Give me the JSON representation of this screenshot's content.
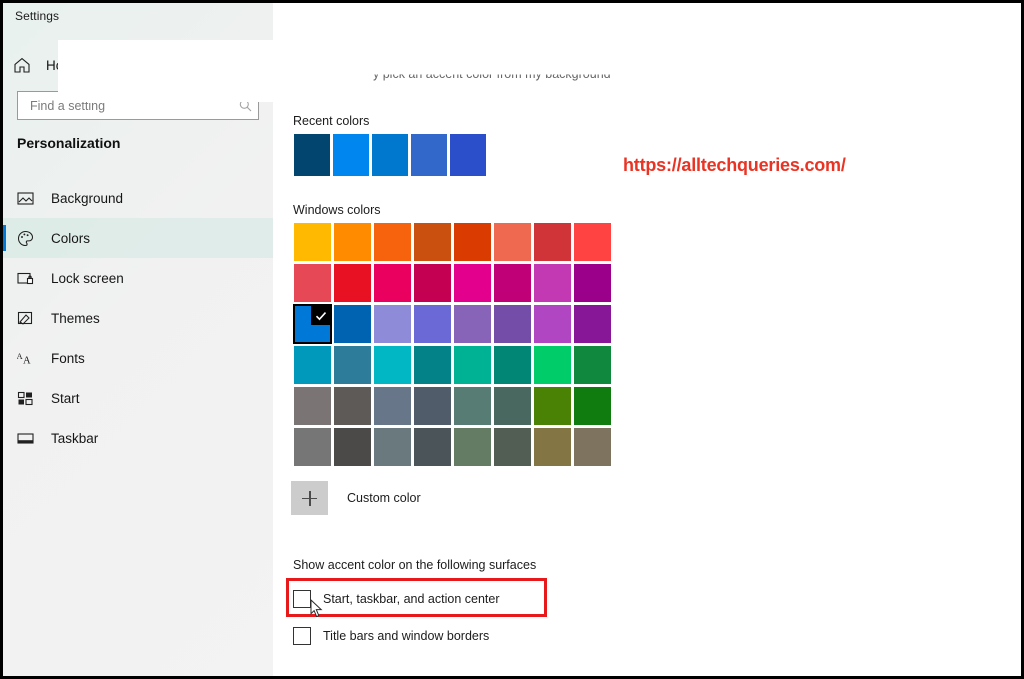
{
  "window": {
    "title": "Settings"
  },
  "sidebar": {
    "home_label": "Home",
    "home_icon": "home-icon",
    "search": {
      "placeholder": "Find a setting",
      "value": "",
      "icon": "search-icon"
    },
    "section_title": "Personalization",
    "items": [
      {
        "label": "Background",
        "icon": "image-icon",
        "selected": false
      },
      {
        "label": "Colors",
        "icon": "palette-icon",
        "selected": true
      },
      {
        "label": "Lock screen",
        "icon": "lock-screen-icon",
        "selected": false
      },
      {
        "label": "Themes",
        "icon": "brush-icon",
        "selected": false
      },
      {
        "label": "Fonts",
        "icon": "fonts-icon",
        "selected": false
      },
      {
        "label": "Start",
        "icon": "start-icon",
        "selected": false
      },
      {
        "label": "Taskbar",
        "icon": "taskbar-icon",
        "selected": false
      }
    ]
  },
  "main": {
    "clipped_top_text": "y pick an accent color from my background",
    "recent_colors_label": "Recent colors",
    "recent_colors": [
      "#02456f",
      "#0086ef",
      "#0078ce",
      "#3168c9",
      "#2b4fcb"
    ],
    "windows_colors_label": "Windows colors",
    "windows_colors": [
      [
        "#ffb901",
        "#ff8c00",
        "#f7630c",
        "#ca5010",
        "#da3b01",
        "#ef6950",
        "#d13438",
        "#ff4343"
      ],
      [
        "#e74856",
        "#e81123",
        "#ea005e",
        "#c30052",
        "#e3008c",
        "#bf0077",
        "#c239b3",
        "#9a0089"
      ],
      [
        "#0078d7",
        "#0063b1",
        "#8e8cd8",
        "#6b69d6",
        "#8764b8",
        "#744da9",
        "#b146c2",
        "#881798"
      ],
      [
        "#0099bc",
        "#2d7d9a",
        "#00b7c3",
        "#038387",
        "#00b294",
        "#018574",
        "#00cc6a",
        "#10893e"
      ],
      [
        "#7a7574",
        "#5d5a58",
        "#68768a",
        "#515c6b",
        "#567c73",
        "#486860",
        "#498205",
        "#107c10"
      ],
      [
        "#767676",
        "#4c4a48",
        "#69797e",
        "#4a5459",
        "#647c64",
        "#525e54",
        "#847545",
        "#7e735f"
      ]
    ],
    "selected_color": {
      "row": 2,
      "col": 0,
      "hex": "#0078d7",
      "check_icon": "check-icon"
    },
    "custom_color_label": "Custom color",
    "custom_color_icon": "plus-icon",
    "surfaces_label": "Show accent color on the following surfaces",
    "surface_options": [
      {
        "label": "Start, taskbar, and action center",
        "checked": false,
        "highlighted": true
      },
      {
        "label": "Title bars and window borders",
        "checked": false,
        "highlighted": false
      }
    ]
  },
  "annotations": {
    "watermark_text": "https://alltechqueries.com/",
    "watermark_color": "#ea3323",
    "highlight_box_color": "#e8191b",
    "cursor_icon": "mouse-pointer-icon"
  }
}
